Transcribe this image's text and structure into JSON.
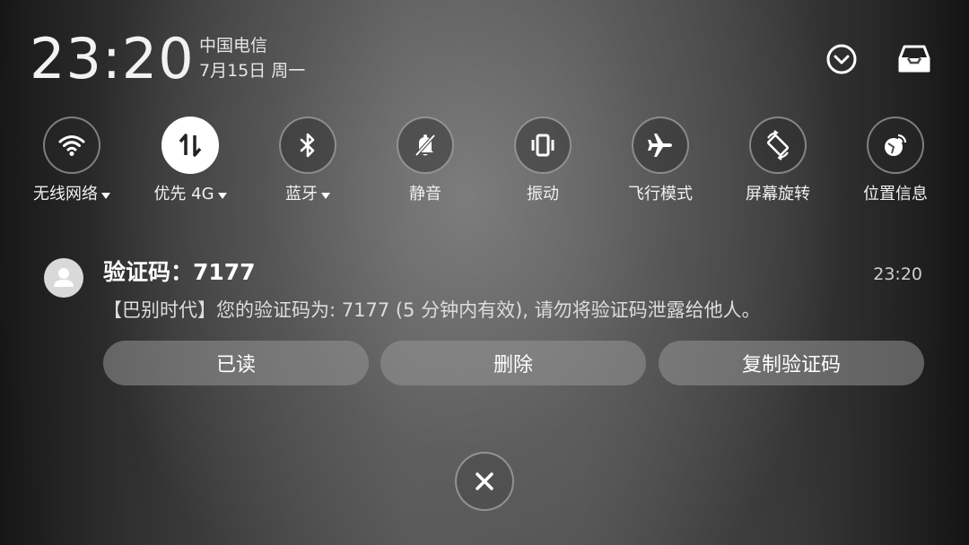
{
  "status": {
    "time": "23:20",
    "carrier": "中国电信",
    "date": "7月15日 周一"
  },
  "header_icons": {
    "collapse": "chevron-down-circle-icon",
    "inbox": "inbox-tray-icon"
  },
  "toggles": [
    {
      "label": "无线网络",
      "icon": "wifi-icon",
      "active": false,
      "has_dropdown": true
    },
    {
      "label": "优先 4G",
      "icon": "mobile-data-icon",
      "active": true,
      "has_dropdown": true
    },
    {
      "label": "蓝牙",
      "icon": "bluetooth-icon",
      "active": false,
      "has_dropdown": true
    },
    {
      "label": "静音",
      "icon": "bell-off-icon",
      "active": false,
      "has_dropdown": false
    },
    {
      "label": "振动",
      "icon": "vibrate-icon",
      "active": false,
      "has_dropdown": false
    },
    {
      "label": "飞行模式",
      "icon": "airplane-icon",
      "active": false,
      "has_dropdown": false
    },
    {
      "label": "屏幕旋转",
      "icon": "screen-rotate-icon",
      "active": false,
      "has_dropdown": false
    },
    {
      "label": "位置信息",
      "icon": "location-icon",
      "active": false,
      "has_dropdown": false
    }
  ],
  "notification": {
    "title": "验证码：7177",
    "time": "23:20",
    "body": "【巴别时代】您的验证码为: 7177 (5 分钟内有效), 请勿将验证码泄露给他人。",
    "actions": {
      "mark_read": "已读",
      "delete": "删除",
      "copy_code": "复制验证码"
    }
  },
  "colors": {
    "active_toggle_bg": "#ffffff",
    "text": "#ffffff"
  }
}
